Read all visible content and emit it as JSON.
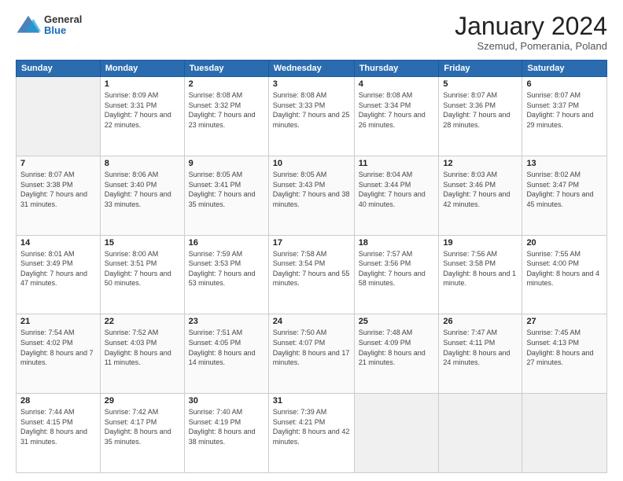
{
  "header": {
    "logo": {
      "general": "General",
      "blue": "Blue"
    },
    "title": "January 2024",
    "subtitle": "Szemud, Pomerania, Poland"
  },
  "days_of_week": [
    "Sunday",
    "Monday",
    "Tuesday",
    "Wednesday",
    "Thursday",
    "Friday",
    "Saturday"
  ],
  "weeks": [
    [
      {
        "day": "",
        "sunrise": "",
        "sunset": "",
        "daylight": "",
        "empty": true
      },
      {
        "day": "1",
        "sunrise": "Sunrise: 8:09 AM",
        "sunset": "Sunset: 3:31 PM",
        "daylight": "Daylight: 7 hours and 22 minutes."
      },
      {
        "day": "2",
        "sunrise": "Sunrise: 8:08 AM",
        "sunset": "Sunset: 3:32 PM",
        "daylight": "Daylight: 7 hours and 23 minutes."
      },
      {
        "day": "3",
        "sunrise": "Sunrise: 8:08 AM",
        "sunset": "Sunset: 3:33 PM",
        "daylight": "Daylight: 7 hours and 25 minutes."
      },
      {
        "day": "4",
        "sunrise": "Sunrise: 8:08 AM",
        "sunset": "Sunset: 3:34 PM",
        "daylight": "Daylight: 7 hours and 26 minutes."
      },
      {
        "day": "5",
        "sunrise": "Sunrise: 8:07 AM",
        "sunset": "Sunset: 3:36 PM",
        "daylight": "Daylight: 7 hours and 28 minutes."
      },
      {
        "day": "6",
        "sunrise": "Sunrise: 8:07 AM",
        "sunset": "Sunset: 3:37 PM",
        "daylight": "Daylight: 7 hours and 29 minutes."
      }
    ],
    [
      {
        "day": "7",
        "sunrise": "Sunrise: 8:07 AM",
        "sunset": "Sunset: 3:38 PM",
        "daylight": "Daylight: 7 hours and 31 minutes."
      },
      {
        "day": "8",
        "sunrise": "Sunrise: 8:06 AM",
        "sunset": "Sunset: 3:40 PM",
        "daylight": "Daylight: 7 hours and 33 minutes."
      },
      {
        "day": "9",
        "sunrise": "Sunrise: 8:05 AM",
        "sunset": "Sunset: 3:41 PM",
        "daylight": "Daylight: 7 hours and 35 minutes."
      },
      {
        "day": "10",
        "sunrise": "Sunrise: 8:05 AM",
        "sunset": "Sunset: 3:43 PM",
        "daylight": "Daylight: 7 hours and 38 minutes."
      },
      {
        "day": "11",
        "sunrise": "Sunrise: 8:04 AM",
        "sunset": "Sunset: 3:44 PM",
        "daylight": "Daylight: 7 hours and 40 minutes."
      },
      {
        "day": "12",
        "sunrise": "Sunrise: 8:03 AM",
        "sunset": "Sunset: 3:46 PM",
        "daylight": "Daylight: 7 hours and 42 minutes."
      },
      {
        "day": "13",
        "sunrise": "Sunrise: 8:02 AM",
        "sunset": "Sunset: 3:47 PM",
        "daylight": "Daylight: 7 hours and 45 minutes."
      }
    ],
    [
      {
        "day": "14",
        "sunrise": "Sunrise: 8:01 AM",
        "sunset": "Sunset: 3:49 PM",
        "daylight": "Daylight: 7 hours and 47 minutes."
      },
      {
        "day": "15",
        "sunrise": "Sunrise: 8:00 AM",
        "sunset": "Sunset: 3:51 PM",
        "daylight": "Daylight: 7 hours and 50 minutes."
      },
      {
        "day": "16",
        "sunrise": "Sunrise: 7:59 AM",
        "sunset": "Sunset: 3:53 PM",
        "daylight": "Daylight: 7 hours and 53 minutes."
      },
      {
        "day": "17",
        "sunrise": "Sunrise: 7:58 AM",
        "sunset": "Sunset: 3:54 PM",
        "daylight": "Daylight: 7 hours and 55 minutes."
      },
      {
        "day": "18",
        "sunrise": "Sunrise: 7:57 AM",
        "sunset": "Sunset: 3:56 PM",
        "daylight": "Daylight: 7 hours and 58 minutes."
      },
      {
        "day": "19",
        "sunrise": "Sunrise: 7:56 AM",
        "sunset": "Sunset: 3:58 PM",
        "daylight": "Daylight: 8 hours and 1 minute."
      },
      {
        "day": "20",
        "sunrise": "Sunrise: 7:55 AM",
        "sunset": "Sunset: 4:00 PM",
        "daylight": "Daylight: 8 hours and 4 minutes."
      }
    ],
    [
      {
        "day": "21",
        "sunrise": "Sunrise: 7:54 AM",
        "sunset": "Sunset: 4:02 PM",
        "daylight": "Daylight: 8 hours and 7 minutes."
      },
      {
        "day": "22",
        "sunrise": "Sunrise: 7:52 AM",
        "sunset": "Sunset: 4:03 PM",
        "daylight": "Daylight: 8 hours and 11 minutes."
      },
      {
        "day": "23",
        "sunrise": "Sunrise: 7:51 AM",
        "sunset": "Sunset: 4:05 PM",
        "daylight": "Daylight: 8 hours and 14 minutes."
      },
      {
        "day": "24",
        "sunrise": "Sunrise: 7:50 AM",
        "sunset": "Sunset: 4:07 PM",
        "daylight": "Daylight: 8 hours and 17 minutes."
      },
      {
        "day": "25",
        "sunrise": "Sunrise: 7:48 AM",
        "sunset": "Sunset: 4:09 PM",
        "daylight": "Daylight: 8 hours and 21 minutes."
      },
      {
        "day": "26",
        "sunrise": "Sunrise: 7:47 AM",
        "sunset": "Sunset: 4:11 PM",
        "daylight": "Daylight: 8 hours and 24 minutes."
      },
      {
        "day": "27",
        "sunrise": "Sunrise: 7:45 AM",
        "sunset": "Sunset: 4:13 PM",
        "daylight": "Daylight: 8 hours and 27 minutes."
      }
    ],
    [
      {
        "day": "28",
        "sunrise": "Sunrise: 7:44 AM",
        "sunset": "Sunset: 4:15 PM",
        "daylight": "Daylight: 8 hours and 31 minutes."
      },
      {
        "day": "29",
        "sunrise": "Sunrise: 7:42 AM",
        "sunset": "Sunset: 4:17 PM",
        "daylight": "Daylight: 8 hours and 35 minutes."
      },
      {
        "day": "30",
        "sunrise": "Sunrise: 7:40 AM",
        "sunset": "Sunset: 4:19 PM",
        "daylight": "Daylight: 8 hours and 38 minutes."
      },
      {
        "day": "31",
        "sunrise": "Sunrise: 7:39 AM",
        "sunset": "Sunset: 4:21 PM",
        "daylight": "Daylight: 8 hours and 42 minutes."
      },
      {
        "day": "",
        "sunrise": "",
        "sunset": "",
        "daylight": "",
        "empty": true
      },
      {
        "day": "",
        "sunrise": "",
        "sunset": "",
        "daylight": "",
        "empty": true
      },
      {
        "day": "",
        "sunrise": "",
        "sunset": "",
        "daylight": "",
        "empty": true
      }
    ]
  ]
}
